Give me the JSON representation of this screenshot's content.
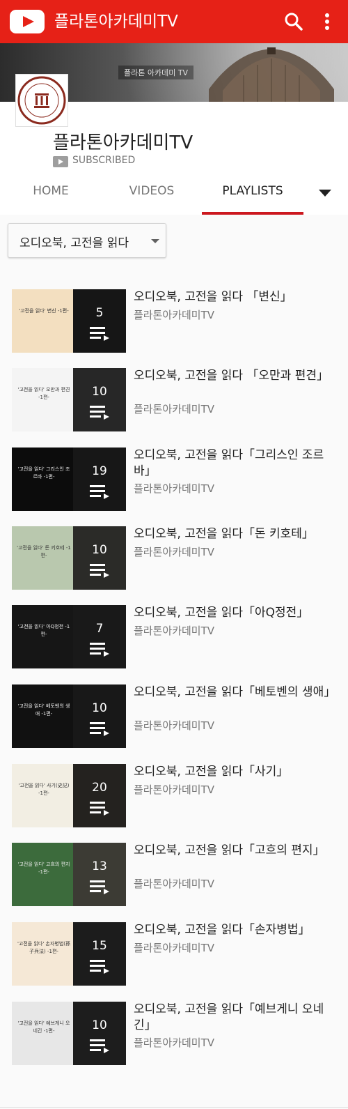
{
  "app": {
    "title": "플라톤아카데미TV"
  },
  "banner": {
    "text": "플라톤 아카데미 TV"
  },
  "channel": {
    "name": "플라톤아카데미TV",
    "subscribed_label": "SUBSCRIBED"
  },
  "tabs": [
    {
      "label": "HOME",
      "active": false
    },
    {
      "label": "VIDEOS",
      "active": false
    },
    {
      "label": "PLAYLISTS",
      "active": true
    }
  ],
  "filter": {
    "selected": "오디오북, 고전을 읽다"
  },
  "colors": {
    "brand": "#e62117",
    "tab_indicator": "#cc181e",
    "secondary_text": "#757575"
  },
  "playlists": [
    {
      "title": "오디오북, 고전을 읽다 「변신」",
      "channel": "플라톤아카데미TV",
      "count": "5",
      "thumb_text": "'고전을 읽다' 변신 -1편-",
      "thumb_bg": "#f3dfc0",
      "thumb_art": "#1d1d1d"
    },
    {
      "title": "오디오북, 고전을 읽다 「오만과 편견」",
      "channel": "플라톤아카데미TV",
      "count": "10",
      "thumb_text": "'고전을 읽다' 오만과 편견 -1편-",
      "thumb_bg": "#f4f4f4",
      "thumb_art": "#6a6a6a"
    },
    {
      "title": "오디오북, 고전을 읽다「그리스인 조르바」",
      "channel": "플라톤아카데미TV",
      "count": "19",
      "thumb_text": "'고전을 읽다' 그리스인 조르바 -1편-",
      "thumb_bg": "#0c0c0c",
      "thumb_art": "#202020"
    },
    {
      "title": "오디오북, 고전을 읽다「돈 키호테」",
      "channel": "플라톤아카데미TV",
      "count": "10",
      "thumb_text": "'고전을 읽다' 돈 키호테 -1편-",
      "thumb_bg": "#b9c8ae",
      "thumb_art": "#7c7c70"
    },
    {
      "title": "오디오북, 고전을 읽다「아Q정전」",
      "channel": "플라톤아카데미TV",
      "count": "7",
      "thumb_text": "'고전을 읽다' 아Q정전 -1편-",
      "thumb_bg": "#161616",
      "thumb_art": "#2a2a2a"
    },
    {
      "title": "오디오북, 고전을 읽다「베토벤의 생애」",
      "channel": "플라톤아카데미TV",
      "count": "10",
      "thumb_text": "'고전을 읽다' 베토벤의 생애 -1편-",
      "thumb_bg": "#111111",
      "thumb_art": "#242424"
    },
    {
      "title": "오디오북, 고전을 읽다「사기」",
      "channel": "플라톤아카데미TV",
      "count": "20",
      "thumb_text": "'고전을 읽다' 사기(史記) -1편-",
      "thumb_bg": "#f2eee3",
      "thumb_art": "#5d5346"
    },
    {
      "title": "오디오북, 고전을 읽다「고흐의 편지」",
      "channel": "플라톤아카데미TV",
      "count": "13",
      "thumb_text": "'고전을 읽다' 고흐의 편지 -1편-",
      "thumb_bg": "#3c6b3c",
      "thumb_art": "#c9c2a4"
    },
    {
      "title": "오디오북, 고전을 읽다「손자병법」",
      "channel": "플라톤아카데미TV",
      "count": "15",
      "thumb_text": "'고전을 읽다' 손자병법(孫子兵法) -1편-",
      "thumb_bg": "#f5e8d6",
      "thumb_art": "#3a3a3a"
    },
    {
      "title": "오디오북, 고전을 읽다「예브게니 오네긴」",
      "channel": "플라톤아카데미TV",
      "count": "10",
      "thumb_text": "'고전을 읽다' 예브게니 오네긴 -1편-",
      "thumb_bg": "#e7e7e7",
      "thumb_art": "#3b3b3b"
    }
  ]
}
